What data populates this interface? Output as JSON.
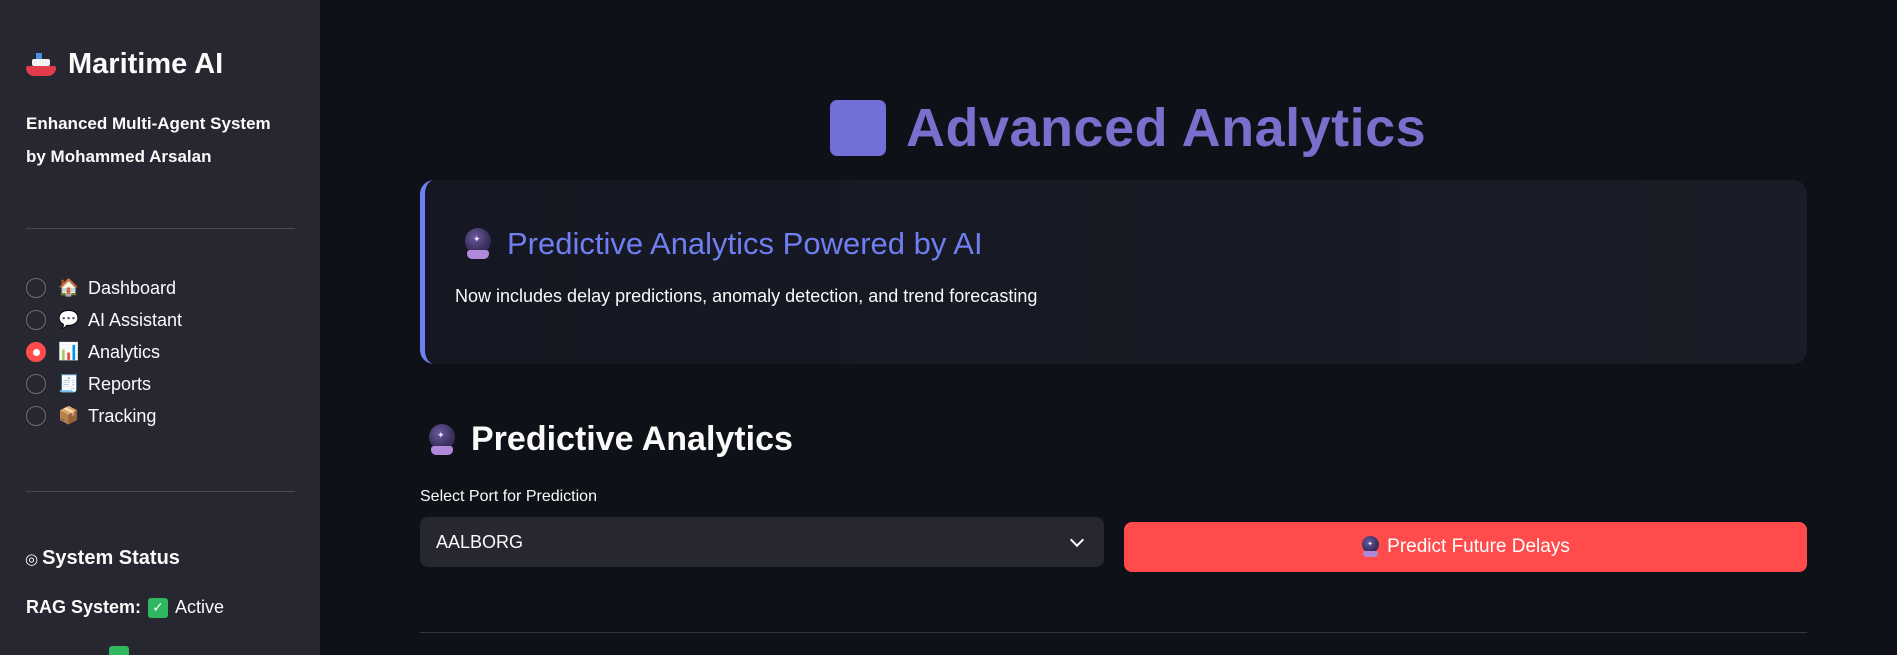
{
  "sidebar": {
    "app_title": "Maritime AI",
    "subtitle_line1": "Enhanced Multi-Agent System",
    "subtitle_line2": "by Mohammed Arsalan",
    "nav": [
      {
        "label": "Dashboard",
        "icon": "house-icon",
        "emoji": "🏠",
        "selected": false
      },
      {
        "label": "AI Assistant",
        "icon": "speech-bubble-icon",
        "emoji": "💬",
        "selected": false
      },
      {
        "label": "Analytics",
        "icon": "bar-chart-icon",
        "emoji": "📊",
        "selected": true
      },
      {
        "label": "Reports",
        "icon": "receipt-icon",
        "emoji": "🧾",
        "selected": false
      },
      {
        "label": "Tracking",
        "icon": "package-icon",
        "emoji": "📦",
        "selected": false
      }
    ],
    "status_heading": "System Status",
    "status_heading_icon": "brain-icon",
    "rag_label": "RAG System:",
    "rag_value": "Active"
  },
  "main": {
    "title": "Advanced Analytics",
    "title_icon_color": "#7070d8",
    "info_card": {
      "title": "Predictive Analytics Powered by AI",
      "text": "Now includes delay predictions, anomaly detection, and trend forecasting",
      "accent": "#6f7ef0"
    },
    "section_title": "Predictive Analytics",
    "select_label": "Select Port for Prediction",
    "selected_port": "AALBORG",
    "predict_button": "Predict Future Delays",
    "predict_button_color": "#ff4b4b"
  }
}
